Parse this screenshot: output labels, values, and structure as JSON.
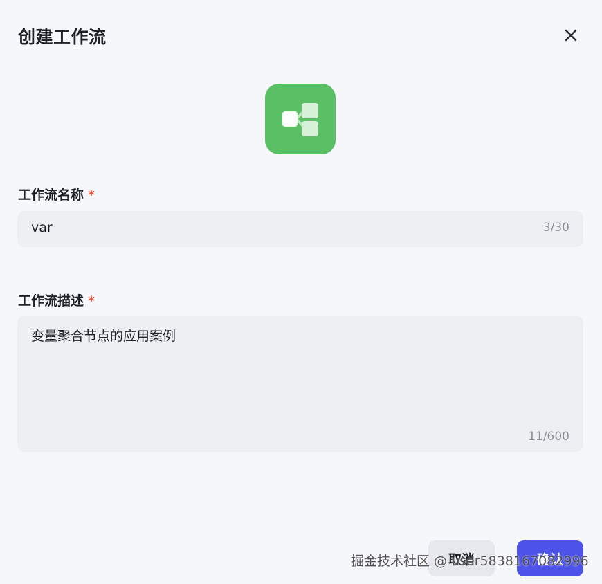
{
  "dialog": {
    "title": "创建工作流",
    "close_icon": "close-icon",
    "app_icon": {
      "name": "workflow-icon",
      "color": "#5bbf65"
    }
  },
  "name_field": {
    "label": "工作流名称",
    "required_mark": "*",
    "value": "var",
    "counter": "3/30"
  },
  "desc_field": {
    "label": "工作流描述",
    "required_mark": "*",
    "value": "变量聚合节点的应用案例",
    "counter": "11/600"
  },
  "buttons": {
    "cancel_label": "取消",
    "confirm_label": "确认",
    "confirm_color": "#4d53e8"
  },
  "watermark": "掘金技术社区 @ user5838167082996"
}
